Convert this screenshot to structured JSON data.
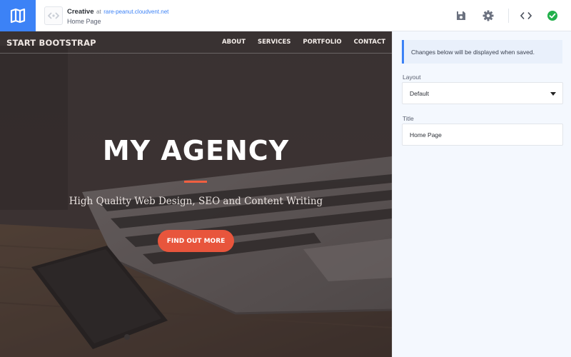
{
  "topbar": {
    "site_name": "Creative",
    "at": "at",
    "domain": "rare-peanut.cloudvent.net",
    "page": "Home Page",
    "icons": [
      "map-icon",
      "code-brackets-icon",
      "save-icon",
      "gear-icon",
      "code-view-icon",
      "checkmark-icon"
    ],
    "accent": "#3c82f6",
    "success": "#22b04b"
  },
  "preview": {
    "brand": "START BOOTSTRAP",
    "nav": [
      "ABOUT",
      "SERVICES",
      "PORTFOLIO",
      "CONTACT"
    ],
    "title": "MY AGENCY",
    "subtitle": "High Quality Web Design, SEO and Content Writing",
    "button": "FIND OUT MORE",
    "accent": "#f05f40"
  },
  "panel": {
    "notice": "Changes below will be displayed when saved.",
    "layout_label": "Layout",
    "layout_value": "Default",
    "title_label": "Title",
    "title_value": "Home Page"
  }
}
